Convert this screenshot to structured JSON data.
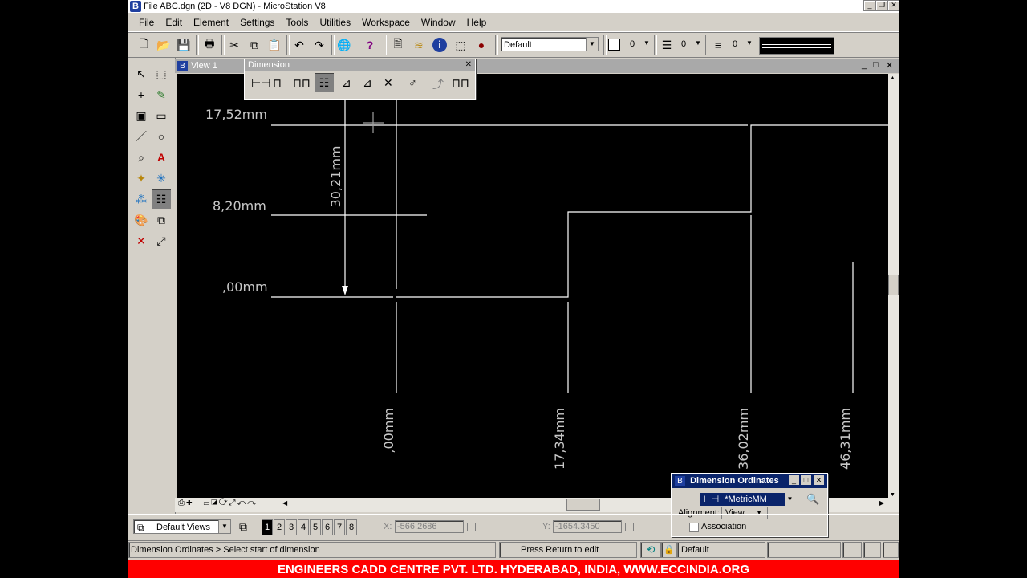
{
  "app": {
    "title": "File ABC.dgn (2D - V8 DGN) - MicroStation V8",
    "menu": [
      "File",
      "Edit",
      "Element",
      "Settings",
      "Tools",
      "Utilities",
      "Workspace",
      "Window",
      "Help"
    ]
  },
  "toolbar": {
    "level_combo": "Default",
    "color_value": "0",
    "style_value": "0",
    "weight_value": "0"
  },
  "view": {
    "title": "View 1"
  },
  "dimension_palette": {
    "title": "Dimension"
  },
  "drawing": {
    "y_labels": [
      "17,52mm",
      "8,20mm",
      ",00mm"
    ],
    "x_labels": [
      ",00mm",
      "17,34mm",
      "36,02mm",
      "46,31mm"
    ],
    "vertical_dim": "30,21mm"
  },
  "dim_ordinates": {
    "title": "Dimension Ordinates",
    "style_value": "*MetricMM",
    "alignment_label": "Alignment:",
    "alignment_value": "View",
    "association_label": "Association"
  },
  "status_bar": {
    "views_combo": "Default Views",
    "view_numbers": [
      "1",
      "2",
      "3",
      "4",
      "5",
      "6",
      "7",
      "8"
    ],
    "x_label": "X:",
    "x_value": "-566.2686",
    "y_label": "Y:",
    "y_value": "-1654.3450"
  },
  "prompt_bar": {
    "prompt": "Dimension Ordinates > Select start of dimension",
    "message": "Press Return to edit dimension",
    "level": "Default"
  },
  "banner": {
    "text": "ENGINEERS CADD CENTRE PVT. LTD. HYDERABAD, INDIA, WWW.ECCINDIA.ORG"
  },
  "colors": {
    "canvas_bg": "#000000",
    "geometry": "#ffffff",
    "dim_text": "#c8c8c8",
    "banner": "#ff0000"
  }
}
